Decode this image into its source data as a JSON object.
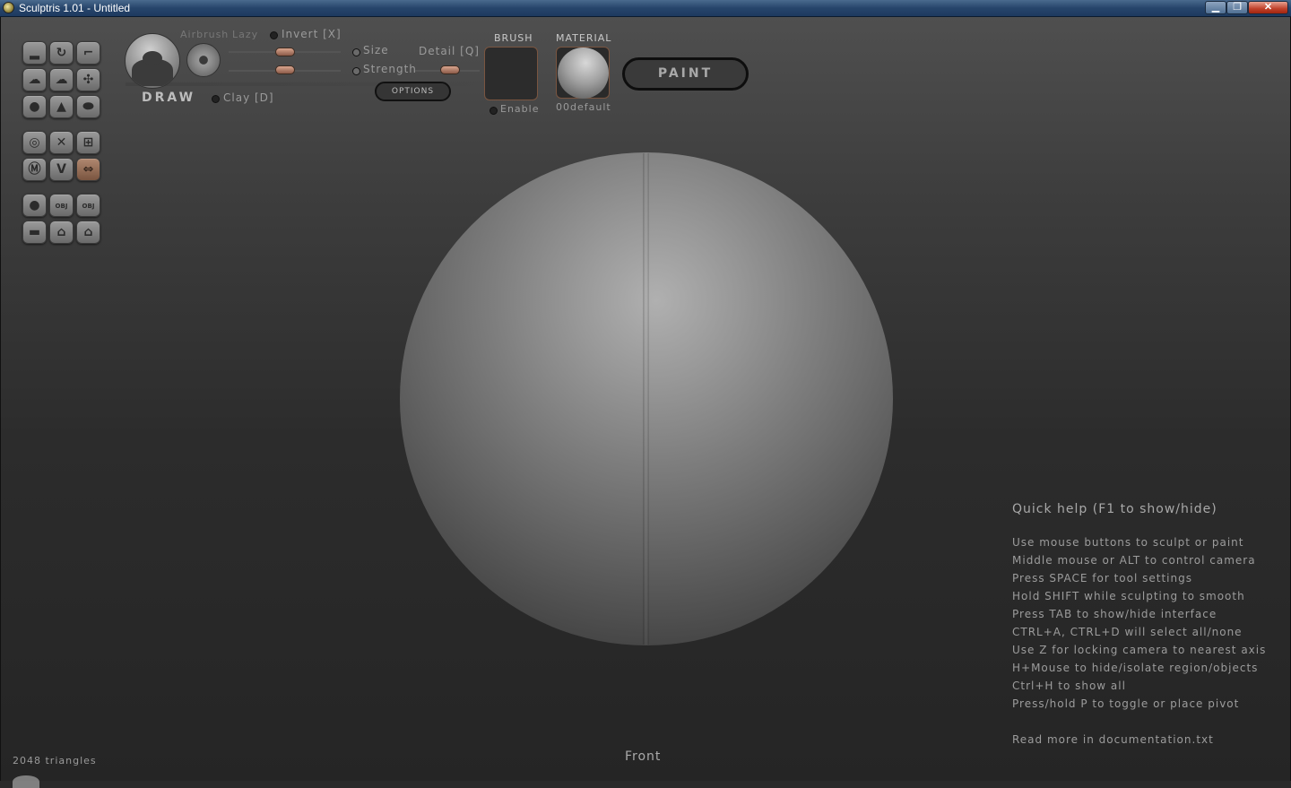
{
  "window": {
    "title": "Sculptris 1.01 - Untitled",
    "min_glyph": "▁",
    "max_glyph": "❐",
    "close_glyph": "✕"
  },
  "tools": {
    "brush_name": "DRAW",
    "airbrush_label": "Airbrush",
    "lazy_label": "Lazy",
    "invert_label": "Invert [X]",
    "size_label": "Size",
    "detail_label": "Detail [Q]",
    "strength_label": "Strength",
    "clay_label": "Clay [D]",
    "options_label": "OPTIONS",
    "brush_header": "BRUSH",
    "enable_label": "Enable",
    "material_header": "MATERIAL",
    "material_name": "00default",
    "paint_label": "PAINT"
  },
  "palette": {
    "obj_text": "OBJ"
  },
  "help": {
    "title": "Quick help (F1 to show/hide)",
    "lines": [
      "Use mouse buttons to sculpt or paint",
      "Middle mouse or ALT to control camera",
      "Press SPACE for tool settings",
      "Hold SHIFT while sculpting to smooth",
      "Press TAB to show/hide interface",
      "CTRL+A, CTRL+D will select all/none",
      "Use Z for locking camera to nearest axis",
      "H+Mouse to hide/isolate region/objects",
      "Ctrl+H to show all",
      "Press/hold P to toggle or place pivot"
    ],
    "more": "Read more in documentation.txt"
  },
  "status": {
    "triangles": "2048 triangles",
    "view": "Front"
  },
  "colors": {
    "accent": "#7a5540",
    "slider_thumb": "#c8907a"
  }
}
